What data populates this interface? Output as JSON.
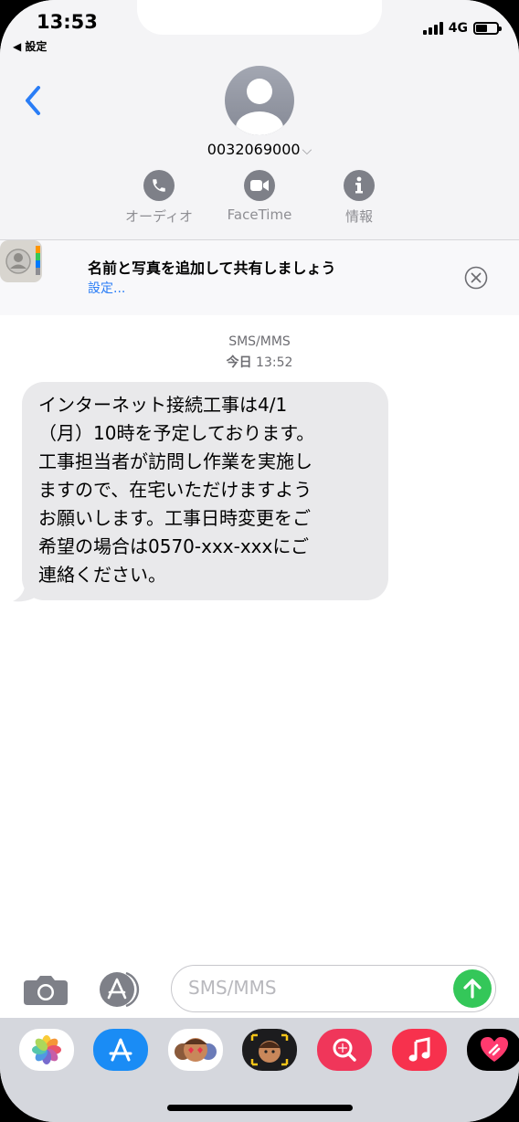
{
  "status_bar": {
    "time": "13:53",
    "back_app": "◀ 設定",
    "network": "4G",
    "battery_level": 0.55
  },
  "header": {
    "contact_number": "0032069000",
    "contact_chevron": "⌵",
    "actions": [
      {
        "label": "オーディオ",
        "icon": "phone-icon"
      },
      {
        "label": "FaceTime",
        "icon": "video-icon"
      },
      {
        "label": "情報",
        "icon": "info-icon"
      }
    ]
  },
  "banner": {
    "title": "名前と写真を追加して共有しましょう",
    "link": "設定..."
  },
  "conversation": {
    "service": "SMS/MMS",
    "timestamp_day": "今日",
    "timestamp_time": "13:52",
    "message": "インターネット接続工事は4/1\n（月）10時を予定しております。\n工事担当者が訪問し作業を実施し\nますので、在宅いただけますよう\nお願いします。工事日時変更をご\n希望の場合は0570-xxx-xxxにご\n連絡ください。"
  },
  "composer": {
    "placeholder": "SMS/MMS"
  },
  "app_tray": [
    "photos-icon",
    "app-store-icon",
    "memoji-stickers-icon",
    "memoji-icon",
    "search-images-icon",
    "music-icon",
    "digital-touch-icon"
  ],
  "colors": {
    "accent": "#2a7df6",
    "send": "#34c759",
    "bubble": "#e9e9eb"
  }
}
